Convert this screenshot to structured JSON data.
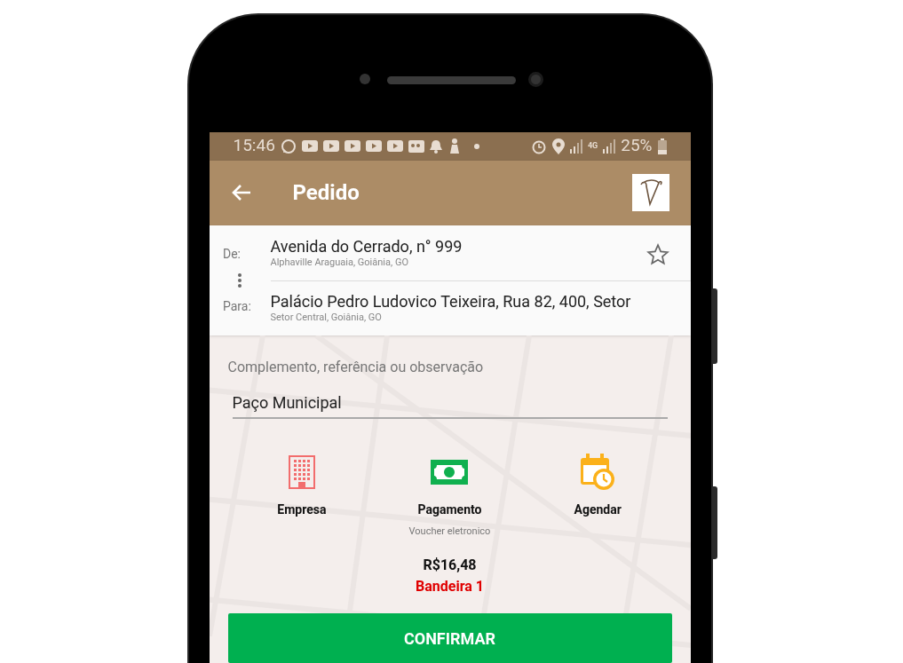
{
  "status_bar": {
    "time": "15:46",
    "network": "4G",
    "battery": "25%"
  },
  "toolbar": {
    "title": "Pedido"
  },
  "route": {
    "favorite": false,
    "stops": [
      {
        "label": "De:",
        "address": "Avenida do Cerrado, n° 999",
        "locality": "Alphaville Araguaia, Goiânia, GO"
      },
      {
        "label": "Para:",
        "address": "Palácio Pedro Ludovico Teixeira, Rua 82, 400, Setor",
        "locality": "Setor Central, Goiânia, GO"
      }
    ]
  },
  "complement": {
    "label": "Complemento, referência ou observação",
    "value": "Paço Municipal"
  },
  "options": [
    {
      "kind": "company",
      "label": "Empresa"
    },
    {
      "kind": "payment",
      "label": "Pagamento",
      "detail": "Voucher eletronico"
    },
    {
      "kind": "schedule",
      "label": "Agendar"
    }
  ],
  "fare": {
    "price": "R$16,48",
    "flag": "Bandeira 1"
  },
  "confirm_button": "CONFIRMAR"
}
